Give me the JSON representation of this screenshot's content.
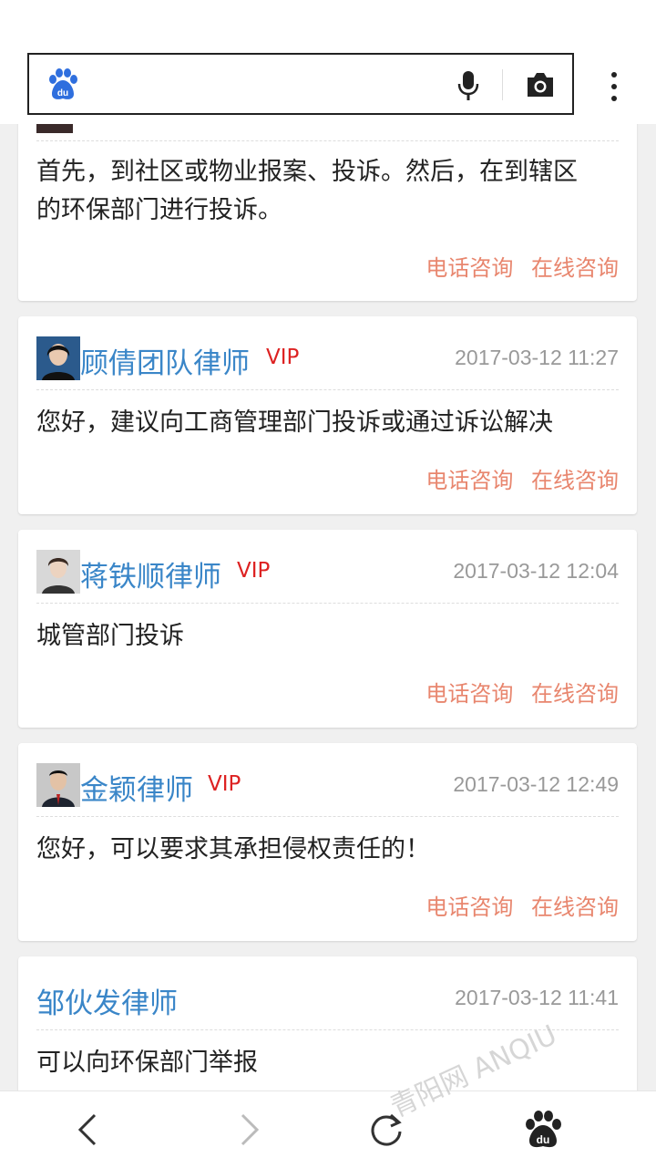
{
  "search": {
    "placeholder": ""
  },
  "cards": [
    {
      "answer": "首先，到社区或物业报案、投诉。然后，在到辖区的环保部门进行投诉。",
      "answer_line1": "首先，到社区或物业报案、投诉。然后，在到辖区",
      "answer_line2": "的环保部门进行投诉。",
      "phone_label": "电话咨询",
      "online_label": "在线咨询"
    },
    {
      "lawyer": "顾倩团队律师",
      "vip": "VIP",
      "time": "2017-03-12 11:27",
      "answer": "您好，建议向工商管理部门投诉或通过诉讼解决",
      "phone_label": "电话咨询",
      "online_label": "在线咨询"
    },
    {
      "lawyer": "蒋铁顺律师",
      "vip": "VIP",
      "time": "2017-03-12 12:04",
      "answer": "城管部门投诉",
      "phone_label": "电话咨询",
      "online_label": "在线咨询"
    },
    {
      "lawyer": "金颖律师",
      "vip": "VIP",
      "time": "2017-03-12 12:49",
      "answer": "您好，可以要求其承担侵权责任的！",
      "phone_label": "电话咨询",
      "online_label": "在线咨询"
    },
    {
      "lawyer": "邹伙发律师",
      "time": "2017-03-12 11:41",
      "answer": "可以向环保部门举报"
    }
  ],
  "watermark": "青阳网 ANQIU",
  "colors": {
    "lawyer": "#3a86c8",
    "vip": "#dd2222",
    "action": "#e8866e"
  }
}
